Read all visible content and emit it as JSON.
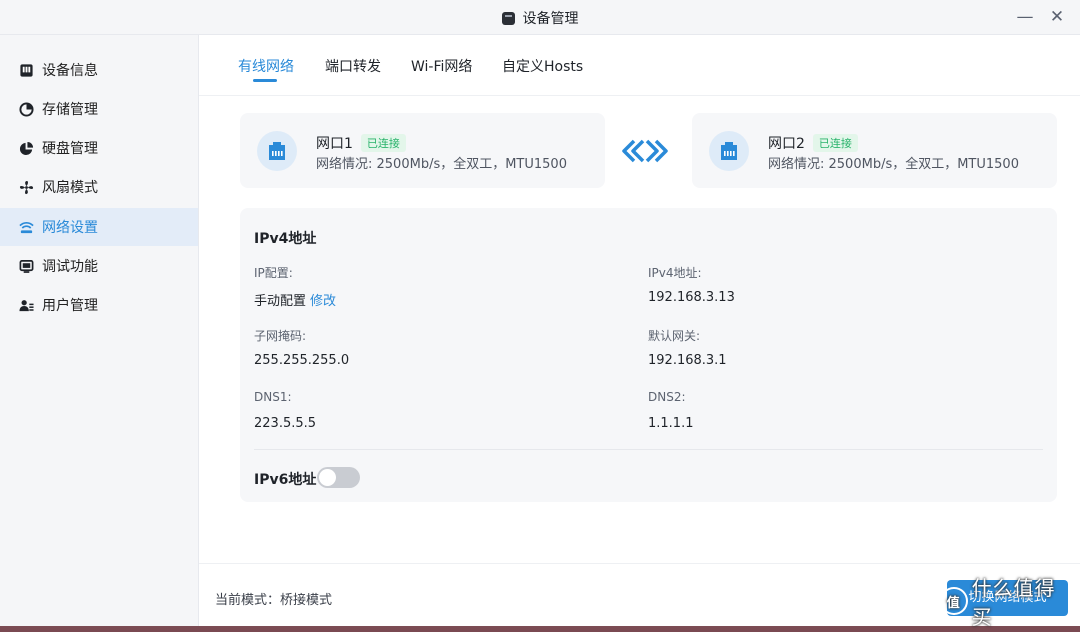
{
  "window": {
    "title": "设备管理",
    "minimize_glyph": "—",
    "close_glyph": "✕"
  },
  "sidebar": {
    "items": [
      {
        "label": "设备信息",
        "icon": "device-info-icon"
      },
      {
        "label": "存储管理",
        "icon": "pie-chart-icon"
      },
      {
        "label": "硬盘管理",
        "icon": "disk-pie-icon"
      },
      {
        "label": "风扇模式",
        "icon": "fan-icon"
      },
      {
        "label": "网络设置",
        "icon": "wifi-icon",
        "active": true
      },
      {
        "label": "调试功能",
        "icon": "monitor-icon"
      },
      {
        "label": "用户管理",
        "icon": "users-icon"
      }
    ]
  },
  "tabs": [
    {
      "label": "有线网络",
      "active": true
    },
    {
      "label": "端口转发"
    },
    {
      "label": "Wi-Fi网络"
    },
    {
      "label": "自定义Hosts"
    }
  ],
  "ports": [
    {
      "name": "网口1",
      "status": "已连接",
      "desc": "网络情况: 2500Mb/s，全双工，MTU1500",
      "icon": "ethernet-port-icon"
    },
    {
      "name": "网口2",
      "status": "已连接",
      "desc": "网络情况: 2500Mb/s，全双工，MTU1500",
      "icon": "ethernet-port-icon"
    }
  ],
  "link_icon": "bridge-arrows-icon",
  "ipv4": {
    "title": "IPv4地址",
    "ip_config_label": "IP配置:",
    "ip_config_value": "手动配置",
    "edit_link": "修改",
    "ipv4_label": "IPv4地址:",
    "ipv4_value": "192.168.3.13",
    "subnet_label": "子网掩码:",
    "subnet_value": "255.255.255.0",
    "gateway_label": "默认网关:",
    "gateway_value": "192.168.3.1",
    "dns1_label": "DNS1:",
    "dns1_value": "223.5.5.5",
    "dns2_label": "DNS2:",
    "dns2_value": "1.1.1.1"
  },
  "ipv6": {
    "label": "IPv6地址",
    "enabled": false
  },
  "footer": {
    "mode_text": "当前模式：桥接模式",
    "switch_button": "切换网络模式"
  },
  "watermark": {
    "text": "什么值得买",
    "badge": "值"
  },
  "colors": {
    "accent": "#2a8ad8",
    "connected": "#29b36b",
    "active_bg": "#e3ecf8"
  }
}
